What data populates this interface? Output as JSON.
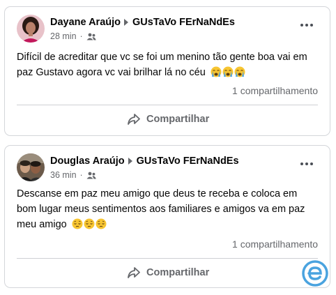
{
  "posts": [
    {
      "author": "Dayane Araújo",
      "target": "GUsTaVo FErNaNdEs",
      "time": "28 min",
      "dot": "·",
      "text": "Difícil de acreditar que vc se foi um menino tão gente boa   vai em paz Gustavo agora vc vai brilhar lá no céu",
      "emojis": [
        "crying-face-emoji",
        "crying-face-emoji",
        "crying-face-emoji"
      ],
      "shares": "1 compartilhamento",
      "share_label": "Compartilhar"
    },
    {
      "author": "Douglas Araújo",
      "target": "GUsTaVo FErNaNdEs",
      "time": "36 min",
      "dot": "·",
      "text": "Descanse em paz meu amigo que deus te receba e coloca em bom lugar meus sentimentos aos familiares e amigos  va em paz meu amigo",
      "emojis": [
        "pensive-face-emoji",
        "pensive-face-emoji",
        "pensive-face-emoji"
      ],
      "shares": "1 compartilhamento",
      "share_label": "Compartilhar"
    }
  ],
  "colors": {
    "secondary_text": "#65676b",
    "border": "#d4d6da",
    "watermark": "#4aa3df"
  },
  "icons": {
    "audience": "friends-icon",
    "share": "share-arrow-icon",
    "more": "more-options-icon",
    "watermark": "e-logo-icon"
  }
}
